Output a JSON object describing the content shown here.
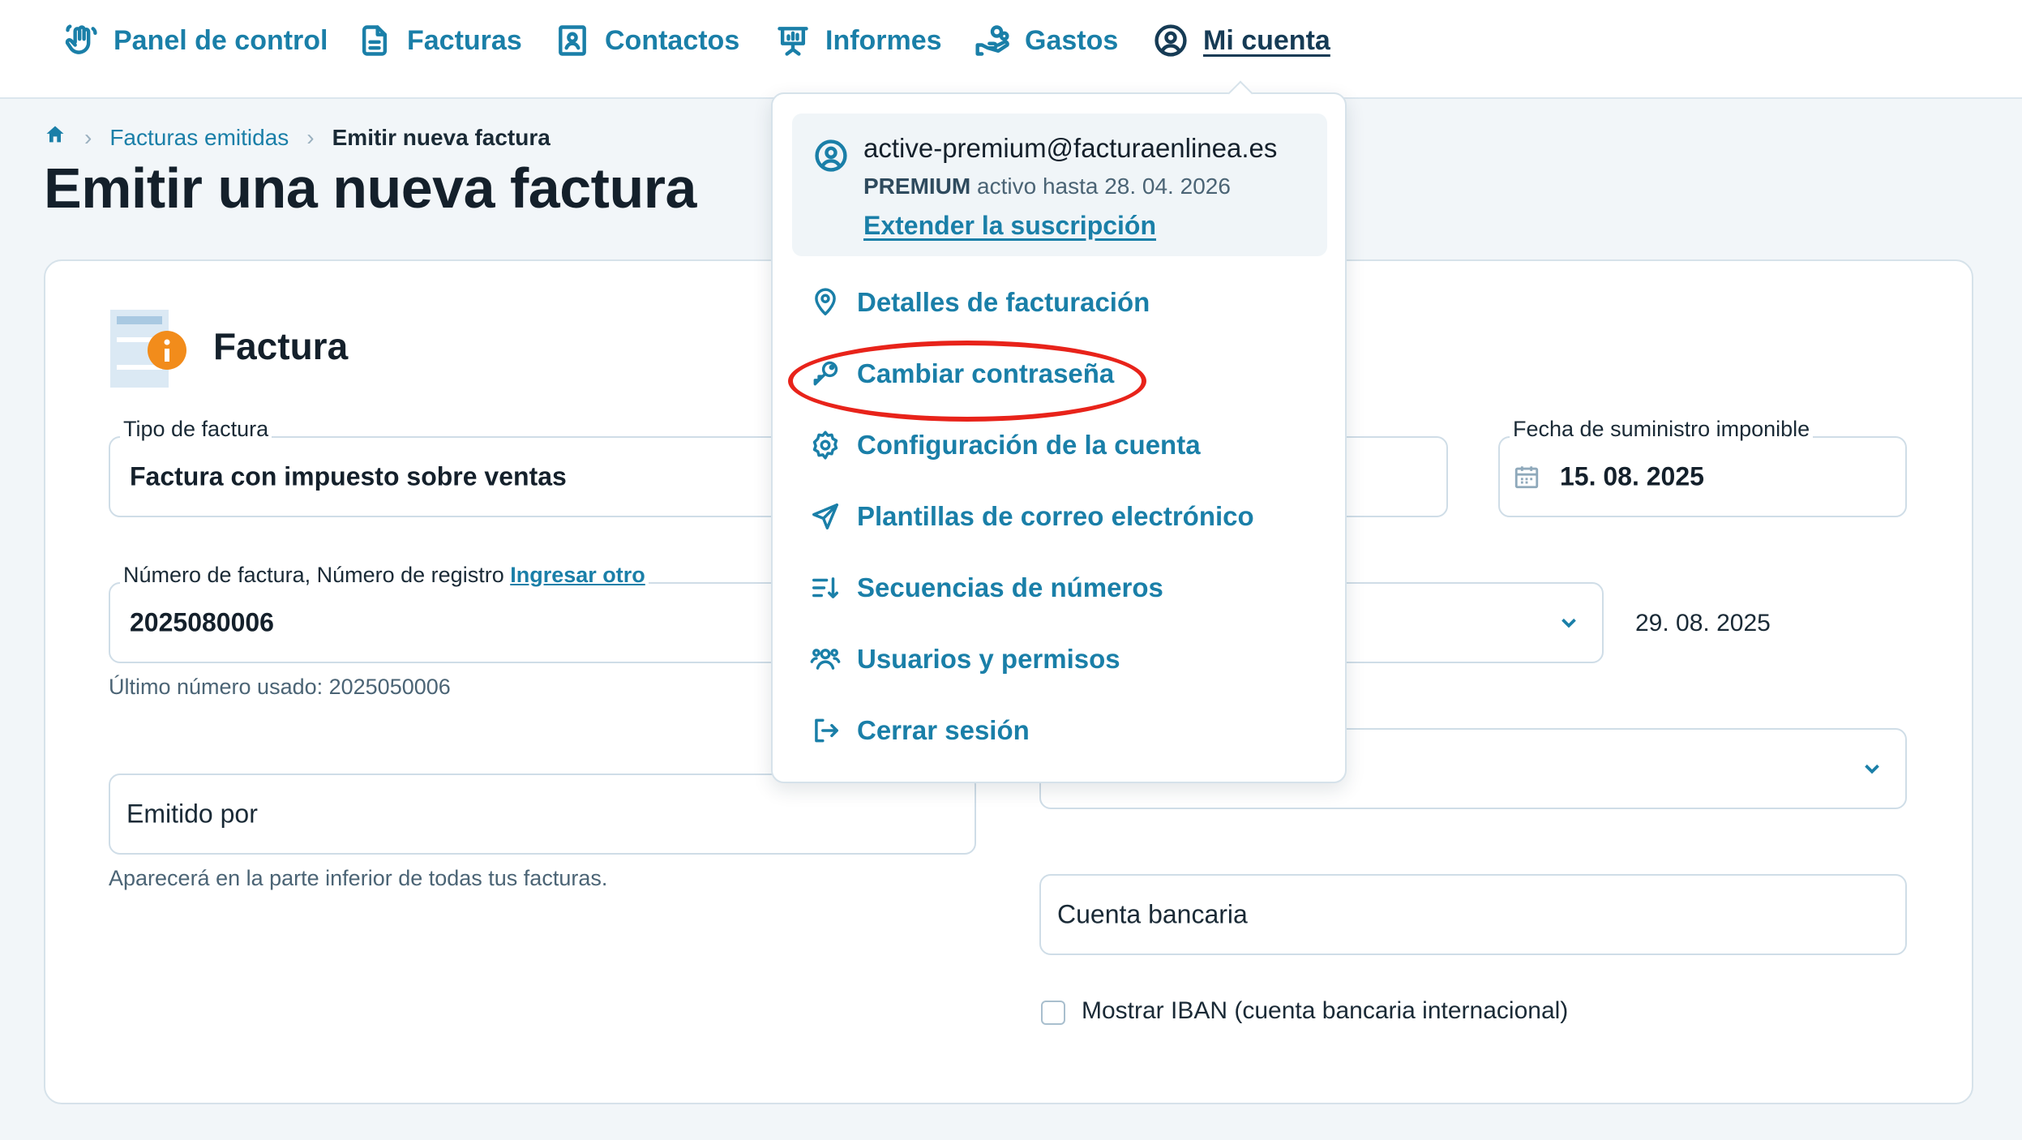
{
  "nav": {
    "items": [
      {
        "label": "Panel de control",
        "icon": "hand-wave-icon"
      },
      {
        "label": "Facturas",
        "icon": "document-icon"
      },
      {
        "label": "Contactos",
        "icon": "contact-card-icon"
      },
      {
        "label": "Informes",
        "icon": "presentation-icon"
      },
      {
        "label": "Gastos",
        "icon": "hand-coins-icon"
      },
      {
        "label": "Mi cuenta",
        "icon": "user-circle-icon"
      }
    ]
  },
  "breadcrumb": {
    "home_icon": "home-icon",
    "parent": "Facturas emitidas",
    "current": "Emitir nueva factura"
  },
  "page_title": "Emitir una nueva factura",
  "section": {
    "title": "Factura",
    "icon": "invoice-info-icon"
  },
  "form": {
    "invoice_type_label": "Tipo de factura",
    "invoice_type_value": "Factura con impuesto sobre ventas",
    "supply_date_label": "Fecha de suministro imponible",
    "supply_date_value": "15. 08. 2025",
    "invoice_number_label": "Número de factura, Número de registro",
    "invoice_number_link": "Ingresar otro",
    "invoice_number_value": "2025080006",
    "last_used": "Último número usado: 2025050006",
    "due_date_value": "29. 08. 2025",
    "issued_by_placeholder": "Emitido por",
    "issued_by_helper": "Aparecerá en la parte inferior de todas tus facturas.",
    "bank_account_placeholder": "Cuenta bancaria",
    "show_iban_label": "Mostrar IBAN (cuenta bancaria internacional)"
  },
  "account_menu": {
    "email": "active-premium@facturaenlinea.es",
    "plan_badge": "PREMIUM",
    "plan_text": " activo hasta 28. 04. 2026",
    "extend_label": "Extender la suscripción",
    "items": [
      {
        "label": "Detalles de facturación",
        "icon": "location-pin-icon"
      },
      {
        "label": "Cambiar contraseña",
        "icon": "key-icon"
      },
      {
        "label": "Configuración de la cuenta",
        "icon": "gear-icon"
      },
      {
        "label": "Plantillas de correo electrónico",
        "icon": "send-icon"
      },
      {
        "label": "Secuencias de números",
        "icon": "sort-numbers-icon"
      },
      {
        "label": "Usuarios y permisos",
        "icon": "users-icon"
      },
      {
        "label": "Cerrar sesión",
        "icon": "logout-icon"
      }
    ]
  },
  "colors": {
    "accent": "#1a7fa8",
    "highlight": "#e8231a",
    "warning_badge": "#f28c1b"
  }
}
